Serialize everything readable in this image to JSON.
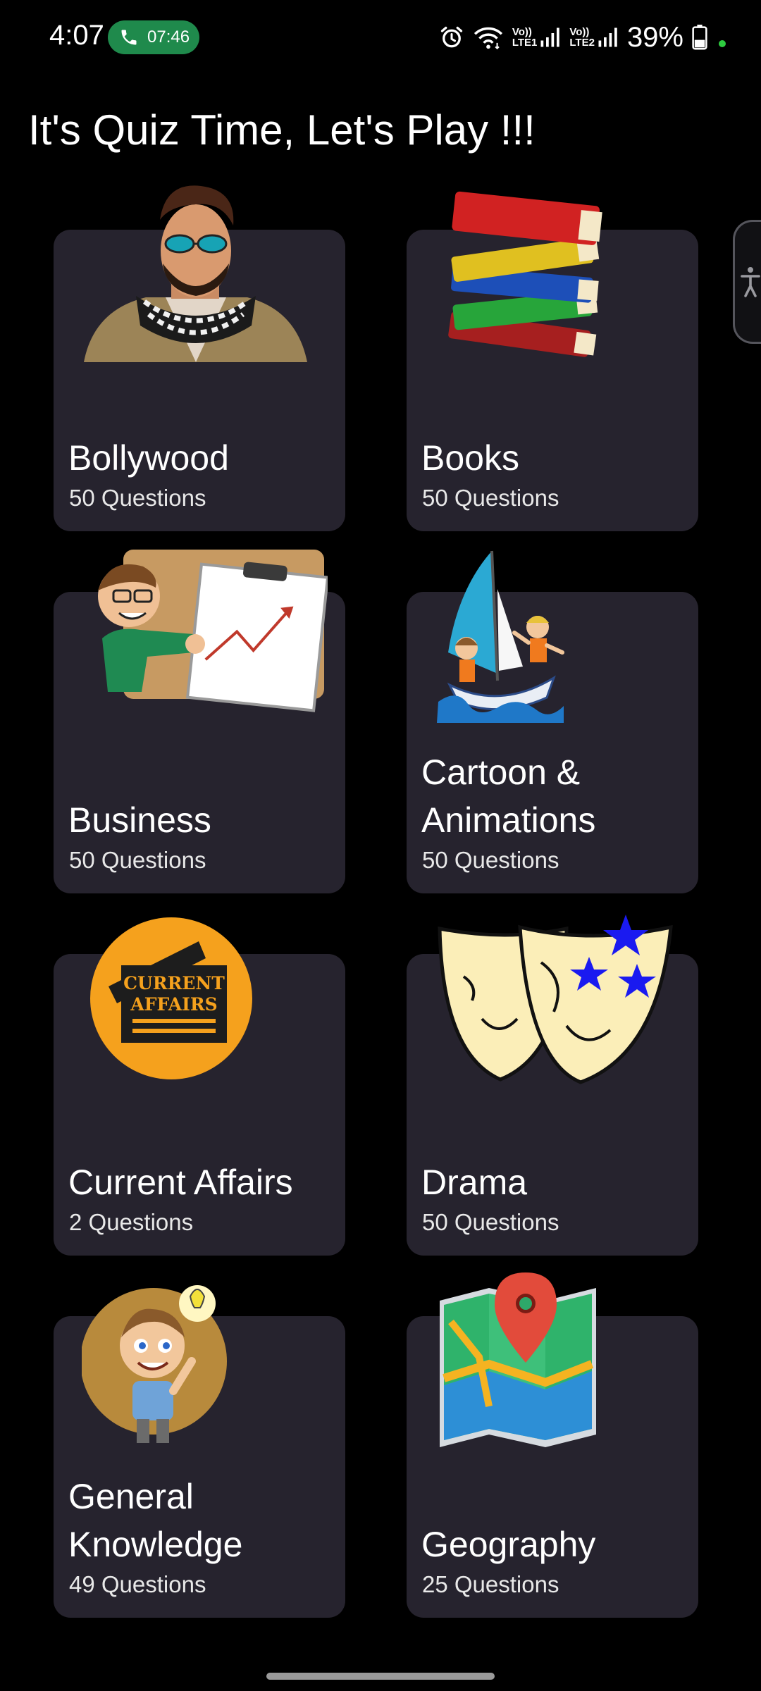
{
  "status_bar": {
    "time": "4:07",
    "call_timer": "07:46",
    "net1_top": "Vo))",
    "net1_bottom": "LTE1",
    "net2_top": "Vo))",
    "net2_bottom": "LTE2",
    "battery_percent": "39%",
    "icons": [
      "phone-icon",
      "alarm-icon",
      "wifi-icon",
      "signal-icon",
      "battery-icon"
    ]
  },
  "header": {
    "title": "It's Quiz Time, Let's Play !!!"
  },
  "categories": [
    {
      "title": "Bollywood",
      "count": "50 Questions",
      "icon": "bollywood-man-icon"
    },
    {
      "title": "Books",
      "count": "50 Questions",
      "icon": "books-stack-icon"
    },
    {
      "title": "Business",
      "count": "50 Questions",
      "icon": "business-presenter-icon"
    },
    {
      "title": "Cartoon &\nAnimations",
      "count": "50 Questions",
      "icon": "cartoon-sailboat-icon"
    },
    {
      "title": "Current Affairs",
      "count": "2 Questions",
      "icon": "current-affairs-icon",
      "badge_line1": "CURRENT",
      "badge_line2": "AFFAIRS"
    },
    {
      "title": "Drama",
      "count": "50 Questions",
      "icon": "drama-masks-icon"
    },
    {
      "title": "General\nKnowledge",
      "count": "49 Questions",
      "icon": "general-knowledge-icon"
    },
    {
      "title": "Geography",
      "count": "25 Questions",
      "icon": "map-pin-icon"
    }
  ],
  "colors": {
    "background": "#000000",
    "card": "#26232e",
    "call_pill": "#1f8a4c",
    "accent_orange": "#f5a11d"
  }
}
